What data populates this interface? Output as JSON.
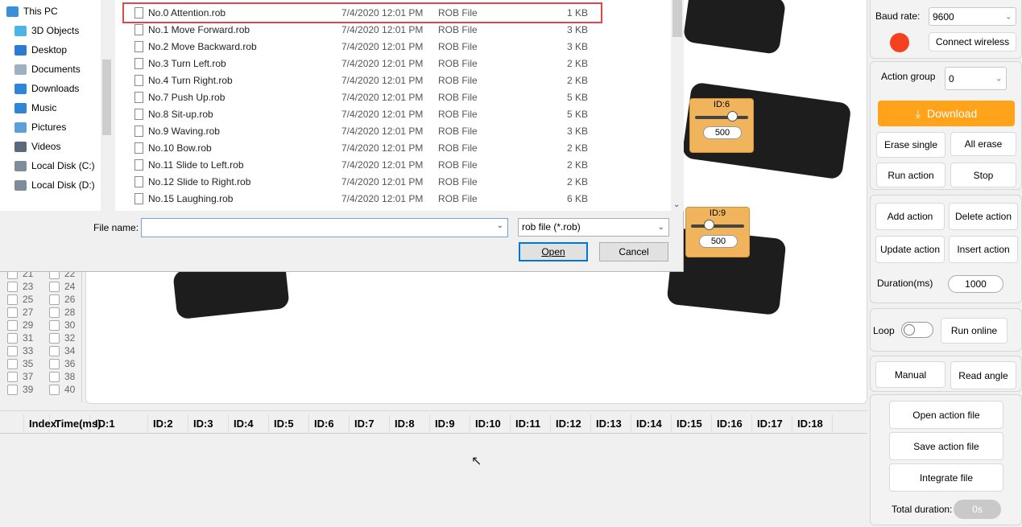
{
  "dialog": {
    "nav": [
      {
        "label": "This PC",
        "icon": "computer-icon"
      },
      {
        "label": "3D Objects",
        "icon": "cube-icon"
      },
      {
        "label": "Desktop",
        "icon": "desktop-icon"
      },
      {
        "label": "Documents",
        "icon": "document-icon"
      },
      {
        "label": "Downloads",
        "icon": "download-arrow-icon"
      },
      {
        "label": "Music",
        "icon": "music-note-icon"
      },
      {
        "label": "Pictures",
        "icon": "picture-icon"
      },
      {
        "label": "Videos",
        "icon": "video-icon"
      },
      {
        "label": "Local Disk (C:)",
        "icon": "disk-icon"
      },
      {
        "label": "Local Disk (D:)",
        "icon": "disk-icon"
      }
    ],
    "files": [
      {
        "name": "No.0 Attention.rob",
        "date": "7/4/2020 12:01 PM",
        "type": "ROB File",
        "size": "1 KB"
      },
      {
        "name": "No.1 Move Forward.rob",
        "date": "7/4/2020 12:01 PM",
        "type": "ROB File",
        "size": "3 KB"
      },
      {
        "name": "No.2 Move Backward.rob",
        "date": "7/4/2020 12:01 PM",
        "type": "ROB File",
        "size": "3 KB"
      },
      {
        "name": "No.3 Turn Left.rob",
        "date": "7/4/2020 12:01 PM",
        "type": "ROB File",
        "size": "2 KB"
      },
      {
        "name": "No.4 Turn Right.rob",
        "date": "7/4/2020 12:01 PM",
        "type": "ROB File",
        "size": "2 KB"
      },
      {
        "name": "No.7 Push Up.rob",
        "date": "7/4/2020 12:01 PM",
        "type": "ROB File",
        "size": "5 KB"
      },
      {
        "name": "No.8 Sit-up.rob",
        "date": "7/4/2020 12:01 PM",
        "type": "ROB File",
        "size": "5 KB"
      },
      {
        "name": "No.9 Waving.rob",
        "date": "7/4/2020 12:01 PM",
        "type": "ROB File",
        "size": "3 KB"
      },
      {
        "name": "No.10 Bow.rob",
        "date": "7/4/2020 12:01 PM",
        "type": "ROB File",
        "size": "2 KB"
      },
      {
        "name": "No.11 Slide to Left.rob",
        "date": "7/4/2020 12:01 PM",
        "type": "ROB File",
        "size": "2 KB"
      },
      {
        "name": "No.12 Slide to Right.rob",
        "date": "7/4/2020 12:01 PM",
        "type": "ROB File",
        "size": "2 KB"
      },
      {
        "name": "No.15 Laughing.rob",
        "date": "7/4/2020 12:01 PM",
        "type": "ROB File",
        "size": "6 KB"
      }
    ],
    "file_name_label": "File name:",
    "file_name_value": "",
    "filter_value": "rob file (*.rob)",
    "open_label": "Open",
    "cancel_label": "Cancel"
  },
  "servos": [
    {
      "label": "ID:6",
      "value": "500"
    },
    {
      "label": "ID:9",
      "value": "500"
    }
  ],
  "checkboxes": [
    "21",
    "22",
    "23",
    "24",
    "25",
    "26",
    "27",
    "28",
    "29",
    "30",
    "31",
    "32",
    "33",
    "34",
    "35",
    "36",
    "37",
    "38",
    "39",
    "40"
  ],
  "table": {
    "headers": [
      "Index",
      "Time(ms)",
      "ID:1",
      "ID:2",
      "ID:3",
      "ID:4",
      "ID:5",
      "ID:6",
      "ID:7",
      "ID:8",
      "ID:9",
      "ID:10",
      "ID:11",
      "ID:12",
      "ID:13",
      "ID:14",
      "ID:15",
      "ID:16",
      "ID:17",
      "ID:18"
    ]
  },
  "right": {
    "baud_label": "Baud rate:",
    "baud_value": "9600",
    "connect_label": "Connect wireless",
    "status_color": "#f5411f",
    "action_group_label": "Action group",
    "action_group_value": "0",
    "download_label": "Download",
    "download_color": "#ffa31a",
    "erase_single": "Erase single",
    "all_erase": "All erase",
    "run_action": "Run action",
    "stop": "Stop",
    "add_action": "Add action",
    "delete_action": "Delete action",
    "update_action": "Update action",
    "insert_action": "Insert action",
    "duration_label": "Duration(ms)",
    "duration_value": "1000",
    "loop_label": "Loop",
    "run_online": "Run online",
    "manual": "Manual",
    "read_angle": "Read angle",
    "open_file": "Open action file",
    "save_file": "Save action file",
    "integrate_file": "Integrate file",
    "total_label": "Total duration:",
    "total_value": "0s"
  }
}
